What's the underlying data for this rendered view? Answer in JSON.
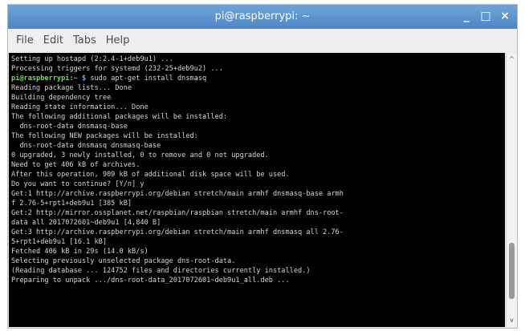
{
  "window": {
    "title": "pi@raspberrypi: ~",
    "minimize_glyph": "_",
    "maximize_glyph": "□",
    "close_glyph": "×"
  },
  "menu": {
    "items": [
      "File",
      "Edit",
      "Tabs",
      "Help"
    ]
  },
  "terminal": {
    "lines": [
      {
        "text": "Setting up hostapd (2:2.4-1+deb9u1) ..."
      },
      {
        "text": "Processing triggers for systemd (232-25+deb9u2) ..."
      },
      {
        "prompt": "pi@raspberrypi",
        "sep": ":",
        "path": "~ $",
        "text": " sudo apt-get install dnsmasq"
      },
      {
        "text": "Reading package lists... Done"
      },
      {
        "text": "Building dependency tree"
      },
      {
        "text": "Reading state information... Done"
      },
      {
        "text": "The following additional packages will be installed:"
      },
      {
        "text": "  dns-root-data dnsmasq-base"
      },
      {
        "text": "The following NEW packages will be installed:"
      },
      {
        "text": "  dns-root-data dnsmasq dnsmasq-base"
      },
      {
        "text": "0 upgraded, 3 newly installed, 0 to remove and 0 not upgraded."
      },
      {
        "text": "Need to get 406 kB of archives."
      },
      {
        "text": "After this operation, 909 kB of additional disk space will be used."
      },
      {
        "text": "Do you want to continue? [Y/n] y"
      },
      {
        "text": "Get:1 http://archive.raspberrypi.org/debian stretch/main armhf dnsmasq-base armh"
      },
      {
        "text": "f 2.76-5+rpt1+deb9u1 [385 kB]"
      },
      {
        "text": "Get:2 http://mirror.ossplanet.net/raspbian/raspbian stretch/main armhf dns-root-"
      },
      {
        "text": "data all 2017072601~deb9u1 [4,840 B]"
      },
      {
        "text": "Get:3 http://archive.raspberrypi.org/debian stretch/main armhf dnsmasq all 2.76-"
      },
      {
        "text": "5+rpt1+deb9u1 [16.1 kB]"
      },
      {
        "text": "Fetched 406 kB in 29s (14.0 kB/s)"
      },
      {
        "text": "Selecting previously unselected package dns-root-data."
      },
      {
        "text": "(Reading database ... 124752 files and directories currently installed.)"
      },
      {
        "text": "Preparing to unpack .../dns-root-data_2017072601~deb9u1_all.deb ..."
      }
    ]
  },
  "scrollbar": {
    "up_glyph": "^",
    "down_glyph": "v",
    "position_fraction": 0.92
  }
}
